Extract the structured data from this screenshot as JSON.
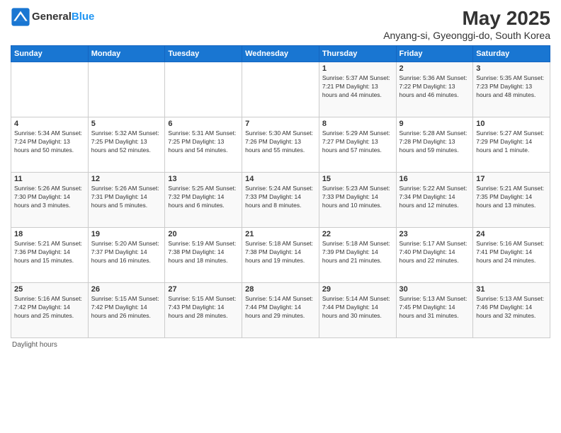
{
  "header": {
    "logo_general": "General",
    "logo_blue": "Blue",
    "month_year": "May 2025",
    "location": "Anyang-si, Gyeonggi-do, South Korea"
  },
  "days_of_week": [
    "Sunday",
    "Monday",
    "Tuesday",
    "Wednesday",
    "Thursday",
    "Friday",
    "Saturday"
  ],
  "footer": {
    "daylight_hours_label": "Daylight hours"
  },
  "weeks": [
    {
      "days": [
        {
          "num": "",
          "info": ""
        },
        {
          "num": "",
          "info": ""
        },
        {
          "num": "",
          "info": ""
        },
        {
          "num": "",
          "info": ""
        },
        {
          "num": "1",
          "info": "Sunrise: 5:37 AM\nSunset: 7:21 PM\nDaylight: 13 hours\nand 44 minutes."
        },
        {
          "num": "2",
          "info": "Sunrise: 5:36 AM\nSunset: 7:22 PM\nDaylight: 13 hours\nand 46 minutes."
        },
        {
          "num": "3",
          "info": "Sunrise: 5:35 AM\nSunset: 7:23 PM\nDaylight: 13 hours\nand 48 minutes."
        }
      ]
    },
    {
      "days": [
        {
          "num": "4",
          "info": "Sunrise: 5:34 AM\nSunset: 7:24 PM\nDaylight: 13 hours\nand 50 minutes."
        },
        {
          "num": "5",
          "info": "Sunrise: 5:32 AM\nSunset: 7:25 PM\nDaylight: 13 hours\nand 52 minutes."
        },
        {
          "num": "6",
          "info": "Sunrise: 5:31 AM\nSunset: 7:25 PM\nDaylight: 13 hours\nand 54 minutes."
        },
        {
          "num": "7",
          "info": "Sunrise: 5:30 AM\nSunset: 7:26 PM\nDaylight: 13 hours\nand 55 minutes."
        },
        {
          "num": "8",
          "info": "Sunrise: 5:29 AM\nSunset: 7:27 PM\nDaylight: 13 hours\nand 57 minutes."
        },
        {
          "num": "9",
          "info": "Sunrise: 5:28 AM\nSunset: 7:28 PM\nDaylight: 13 hours\nand 59 minutes."
        },
        {
          "num": "10",
          "info": "Sunrise: 5:27 AM\nSunset: 7:29 PM\nDaylight: 14 hours\nand 1 minute."
        }
      ]
    },
    {
      "days": [
        {
          "num": "11",
          "info": "Sunrise: 5:26 AM\nSunset: 7:30 PM\nDaylight: 14 hours\nand 3 minutes."
        },
        {
          "num": "12",
          "info": "Sunrise: 5:26 AM\nSunset: 7:31 PM\nDaylight: 14 hours\nand 5 minutes."
        },
        {
          "num": "13",
          "info": "Sunrise: 5:25 AM\nSunset: 7:32 PM\nDaylight: 14 hours\nand 6 minutes."
        },
        {
          "num": "14",
          "info": "Sunrise: 5:24 AM\nSunset: 7:33 PM\nDaylight: 14 hours\nand 8 minutes."
        },
        {
          "num": "15",
          "info": "Sunrise: 5:23 AM\nSunset: 7:33 PM\nDaylight: 14 hours\nand 10 minutes."
        },
        {
          "num": "16",
          "info": "Sunrise: 5:22 AM\nSunset: 7:34 PM\nDaylight: 14 hours\nand 12 minutes."
        },
        {
          "num": "17",
          "info": "Sunrise: 5:21 AM\nSunset: 7:35 PM\nDaylight: 14 hours\nand 13 minutes."
        }
      ]
    },
    {
      "days": [
        {
          "num": "18",
          "info": "Sunrise: 5:21 AM\nSunset: 7:36 PM\nDaylight: 14 hours\nand 15 minutes."
        },
        {
          "num": "19",
          "info": "Sunrise: 5:20 AM\nSunset: 7:37 PM\nDaylight: 14 hours\nand 16 minutes."
        },
        {
          "num": "20",
          "info": "Sunrise: 5:19 AM\nSunset: 7:38 PM\nDaylight: 14 hours\nand 18 minutes."
        },
        {
          "num": "21",
          "info": "Sunrise: 5:18 AM\nSunset: 7:38 PM\nDaylight: 14 hours\nand 19 minutes."
        },
        {
          "num": "22",
          "info": "Sunrise: 5:18 AM\nSunset: 7:39 PM\nDaylight: 14 hours\nand 21 minutes."
        },
        {
          "num": "23",
          "info": "Sunrise: 5:17 AM\nSunset: 7:40 PM\nDaylight: 14 hours\nand 22 minutes."
        },
        {
          "num": "24",
          "info": "Sunrise: 5:16 AM\nSunset: 7:41 PM\nDaylight: 14 hours\nand 24 minutes."
        }
      ]
    },
    {
      "days": [
        {
          "num": "25",
          "info": "Sunrise: 5:16 AM\nSunset: 7:42 PM\nDaylight: 14 hours\nand 25 minutes."
        },
        {
          "num": "26",
          "info": "Sunrise: 5:15 AM\nSunset: 7:42 PM\nDaylight: 14 hours\nand 26 minutes."
        },
        {
          "num": "27",
          "info": "Sunrise: 5:15 AM\nSunset: 7:43 PM\nDaylight: 14 hours\nand 28 minutes."
        },
        {
          "num": "28",
          "info": "Sunrise: 5:14 AM\nSunset: 7:44 PM\nDaylight: 14 hours\nand 29 minutes."
        },
        {
          "num": "29",
          "info": "Sunrise: 5:14 AM\nSunset: 7:44 PM\nDaylight: 14 hours\nand 30 minutes."
        },
        {
          "num": "30",
          "info": "Sunrise: 5:13 AM\nSunset: 7:45 PM\nDaylight: 14 hours\nand 31 minutes."
        },
        {
          "num": "31",
          "info": "Sunrise: 5:13 AM\nSunset: 7:46 PM\nDaylight: 14 hours\nand 32 minutes."
        }
      ]
    }
  ]
}
